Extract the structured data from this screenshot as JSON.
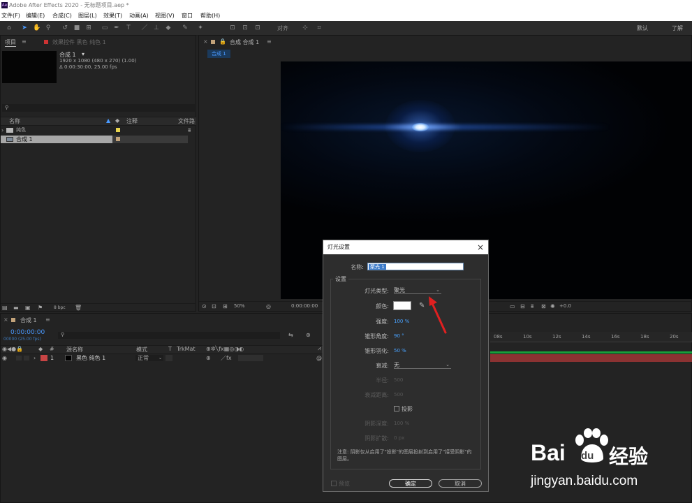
{
  "app": {
    "logo_text": "Ae",
    "title": "Adobe After Effects 2020 - 无标题项目.aep *"
  },
  "menu": [
    "文件(F)",
    "编辑(E)",
    "合成(C)",
    "图层(L)",
    "效果(T)",
    "动画(A)",
    "视图(V)",
    "窗口",
    "帮助(H)"
  ],
  "toolbar": {
    "align_label": "对齐",
    "workspace_default": "默认",
    "workspace_learn": "了解"
  },
  "project_panel": {
    "tab_project": "项目",
    "tab_effects": "效果控件 黑色 纯色 1",
    "comp_name": "合成 1",
    "comp_info_size": "1920 x 1080 (480 x 270) (1.00)",
    "comp_info_duration": "Δ 0:00:30:00, 25.00 fps",
    "col_name": "名称",
    "col_comment": "注释",
    "col_file": "文件路",
    "items": [
      {
        "name": "纯色"
      },
      {
        "name": "合成 1"
      }
    ],
    "bpc_label": "8 bpc"
  },
  "viewer": {
    "tab_label": "合成 合成 1",
    "breadcrumb": "合成 1",
    "zoom": "50%",
    "time": "0:00:00:00",
    "exposure": "+0.0"
  },
  "timeline": {
    "tab_label": "合成 1",
    "timecode": "0:00:00:00",
    "timecode_sub": "00000 (25.00 fps)",
    "col_source": "源名称",
    "col_mode": "模式",
    "col_t": "T",
    "col_trkmat": "TrkMat",
    "layer": {
      "index": "1",
      "name": "黑色 纯色 1",
      "mode": "正常"
    },
    "ruler_ticks": [
      "08s",
      "10s",
      "12s",
      "14s",
      "16s",
      "18s",
      "20s"
    ]
  },
  "dialog": {
    "title": "灯光设置",
    "name_label": "名称:",
    "name_value": "聚光 1",
    "settings_label": "设置",
    "light_type_label": "灯光类型:",
    "light_type_value": "聚光",
    "color_label": "颜色:",
    "intensity_label": "强度:",
    "intensity_value": "100 %",
    "cone_angle_label": "锥形角度:",
    "cone_angle_value": "90 °",
    "cone_feather_label": "锥形羽化:",
    "cone_feather_value": "50 %",
    "falloff_label": "衰减:",
    "falloff_value": "无",
    "radius_label": "半径:",
    "radius_value": "500",
    "falloff_distance_label": "衰减距离:",
    "falloff_distance_value": "500",
    "cast_shadows_label": "投影",
    "shadow_darkness_label": "阴影深度:",
    "shadow_darkness_value": "100 %",
    "shadow_diffusion_label": "阴影扩散:",
    "shadow_diffusion_value": "0 px",
    "note": "注意: 阴影仅从启用了\"投影\"的图层投射到启用了\"接受阴影\"的图层。",
    "preview_label": "预览",
    "ok_label": "确定",
    "cancel_label": "取消"
  },
  "watermark": {
    "brand": "Bai",
    "brand_du": "du",
    "brand_cn": "经验",
    "url": "jingyan.baidu.com"
  }
}
